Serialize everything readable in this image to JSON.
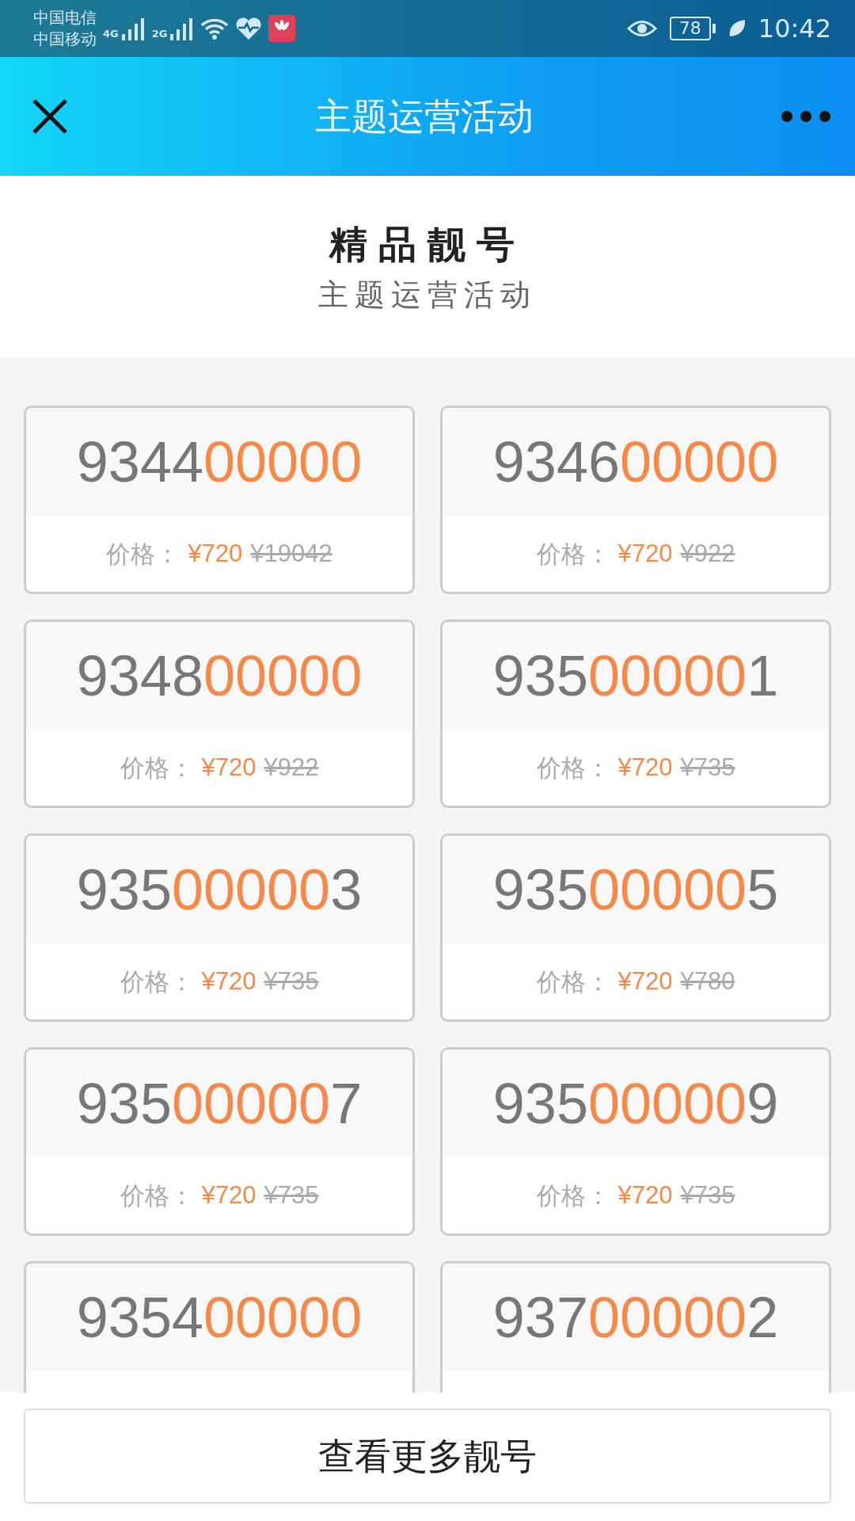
{
  "status_bar": {
    "carriers": [
      "中国电信",
      "中国移动"
    ],
    "networks": [
      "4G",
      "2G"
    ],
    "battery": "78",
    "time": "10:42"
  },
  "header": {
    "title": "主题运营活动"
  },
  "intro": {
    "title": "精品靓号",
    "subtitle": "主题运营活动"
  },
  "numbers": [
    {
      "parts": [
        {
          "text": "9344",
          "highlight": false
        },
        {
          "text": "00000",
          "highlight": true
        }
      ],
      "price_label": "价格：",
      "price": "¥720",
      "old_price": "¥19042"
    },
    {
      "parts": [
        {
          "text": "9346",
          "highlight": false
        },
        {
          "text": "00000",
          "highlight": true
        }
      ],
      "price_label": "价格：",
      "price": "¥720",
      "old_price": "¥922"
    },
    {
      "parts": [
        {
          "text": "9348",
          "highlight": false
        },
        {
          "text": "00000",
          "highlight": true
        }
      ],
      "price_label": "价格：",
      "price": "¥720",
      "old_price": "¥922"
    },
    {
      "parts": [
        {
          "text": "935",
          "highlight": false
        },
        {
          "text": "00000",
          "highlight": true
        },
        {
          "text": "1",
          "highlight": false
        }
      ],
      "price_label": "价格：",
      "price": "¥720",
      "old_price": "¥735"
    },
    {
      "parts": [
        {
          "text": "935",
          "highlight": false
        },
        {
          "text": "00000",
          "highlight": true
        },
        {
          "text": "3",
          "highlight": false
        }
      ],
      "price_label": "价格：",
      "price": "¥720",
      "old_price": "¥735"
    },
    {
      "parts": [
        {
          "text": "935",
          "highlight": false
        },
        {
          "text": "00000",
          "highlight": true
        },
        {
          "text": "5",
          "highlight": false
        }
      ],
      "price_label": "价格：",
      "price": "¥720",
      "old_price": "¥780"
    },
    {
      "parts": [
        {
          "text": "935",
          "highlight": false
        },
        {
          "text": "00000",
          "highlight": true
        },
        {
          "text": "7",
          "highlight": false
        }
      ],
      "price_label": "价格：",
      "price": "¥720",
      "old_price": "¥735"
    },
    {
      "parts": [
        {
          "text": "935",
          "highlight": false
        },
        {
          "text": "00000",
          "highlight": true
        },
        {
          "text": "9",
          "highlight": false
        }
      ],
      "price_label": "价格：",
      "price": "¥720",
      "old_price": "¥735"
    },
    {
      "parts": [
        {
          "text": "9354",
          "highlight": false
        },
        {
          "text": "00000",
          "highlight": true
        }
      ]
    },
    {
      "parts": [
        {
          "text": "937",
          "highlight": false
        },
        {
          "text": "00000",
          "highlight": true
        },
        {
          "text": "2",
          "highlight": false
        }
      ]
    }
  ],
  "more_button": "查看更多靓号"
}
